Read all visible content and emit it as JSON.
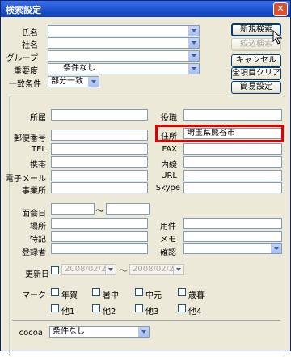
{
  "window": {
    "title": "検索設定",
    "close_glyph": "✕"
  },
  "labels": {
    "name": "氏名",
    "company": "社名",
    "group": "グループ",
    "importance": "重要度",
    "match": "一致条件",
    "dept": "所属",
    "position": "役職",
    "postal": "郵便番号",
    "address": "住所",
    "tel": "TEL",
    "fax": "FAX",
    "mobile": "携帯",
    "ext": "内線",
    "email": "電子メール",
    "url": "URL",
    "office": "事業所",
    "skype": "Skype",
    "meeting_date": "面会日",
    "tilde": "〜",
    "place": "場所",
    "business": "用件",
    "notes": "特記",
    "memo": "メモ",
    "registrant": "登録者",
    "confirm": "確認",
    "updated": "更新日",
    "mark": "マーク",
    "cocoa": "cocoa"
  },
  "values": {
    "importance": "条件なし",
    "match": "部分一致",
    "address": "埼玉県熊谷市",
    "updated_from": "2008/02/28",
    "updated_to": "2008/02/28",
    "cocoa": "条件なし"
  },
  "buttons": {
    "new_search": "新規検索",
    "narrow_search": "絞込検索",
    "cancel": "キャンセル",
    "clear_all": "全項目クリア",
    "simple": "簡易設定"
  },
  "marks": [
    "年賀",
    "暑中",
    "中元",
    "歳暮",
    "他1",
    "他2",
    "他3",
    "他4"
  ],
  "colors": {
    "title_bar": "#2458d6",
    "window_bg": "#ece9d8",
    "highlight": "#e00000"
  }
}
